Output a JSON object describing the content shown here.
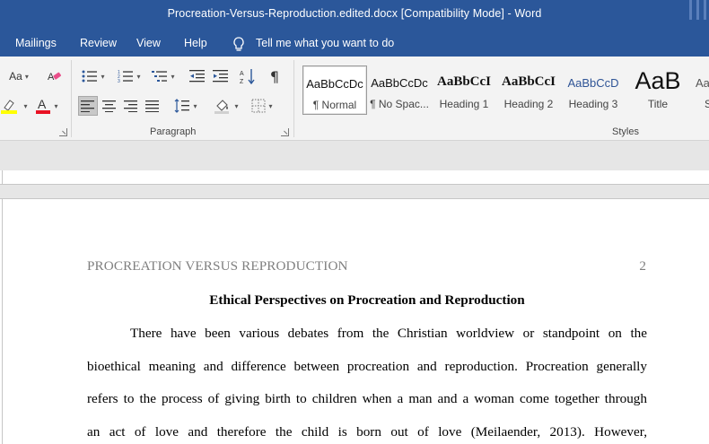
{
  "window": {
    "title": "Procreation-Versus-Reproduction.edited.docx [Compatibility Mode]  -  Word"
  },
  "menu": {
    "items": [
      "Mailings",
      "Review",
      "View",
      "Help"
    ],
    "tell_me": "Tell me what you want to do"
  },
  "ribbon": {
    "font_group": {
      "change_case_label": "Aa"
    },
    "paragraph_group": {
      "label": "Paragraph"
    },
    "styles_group": {
      "label": "Styles",
      "tiles": [
        {
          "preview": "AaBbCcDc",
          "name": "¶ Normal"
        },
        {
          "preview": "AaBbCcDc",
          "name": "¶ No Spac..."
        },
        {
          "preview": "AaBbCcI",
          "name": "Heading 1"
        },
        {
          "preview": "AaBbCcI",
          "name": "Heading 2"
        },
        {
          "preview": "AaBbCcD",
          "name": "Heading 3"
        },
        {
          "preview": "AaB",
          "name": "Title"
        },
        {
          "preview": "Aa",
          "name": "S"
        }
      ]
    }
  },
  "document": {
    "running_head": "PROCREATION VERSUS REPRODUCTION",
    "page_number": "2",
    "heading": "Ethical Perspectives on Procreation and Reproduction",
    "lines": [
      "There have been various debates from the Christian worldview or standpoint on the",
      "bioethical meaning and difference between procreation and reproduction. Procreation generally",
      "refers to the process of giving birth to children when a man and a woman come together through",
      "an act of love and therefore the child is born out of love (Meilaender, 2013). However,"
    ]
  },
  "colors": {
    "title_bar": "#2b579a",
    "ribbon": "#f3f3f3",
    "highlight_yellow": "#ffff00",
    "font_color_red": "#e81123",
    "heading_blue": "#2f5496"
  }
}
